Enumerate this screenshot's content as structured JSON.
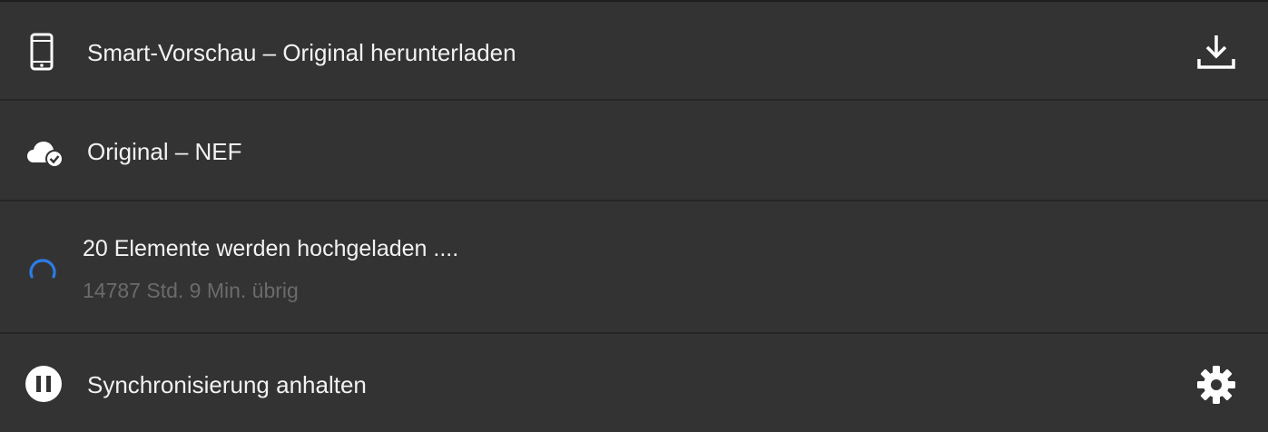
{
  "rows": {
    "smart_preview": {
      "label": "Smart-Vorschau – Original herunterladen",
      "icon": "phone-icon",
      "action_icon": "download-icon"
    },
    "original": {
      "label": "Original – NEF",
      "icon": "cloud-check-icon"
    },
    "upload": {
      "label": "20 Elemente werden hochgeladen ....",
      "sublabel": "14787 Std. 9 Min. übrig",
      "icon": "loading-spinner-icon",
      "spinner_color": "#2d7be5"
    },
    "sync": {
      "label": "Synchronisierung anhalten",
      "icon": "pause-icon",
      "action_icon": "gear-icon"
    }
  },
  "colors": {
    "background": "#333333",
    "divider": "#262626",
    "text": "#f2f2f2",
    "subtext": "#6b6b6b"
  }
}
